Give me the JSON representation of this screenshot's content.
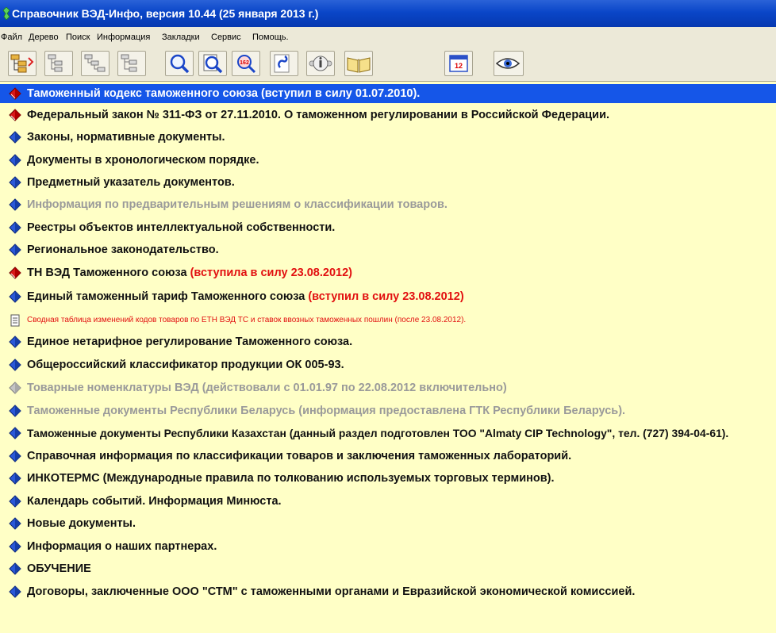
{
  "window": {
    "title": "Справочник ВЭД-Инфо, версия 10.44 (25 января 2013 г.)"
  },
  "menu": [
    {
      "label": "Файл"
    },
    {
      "label": "Дерево"
    },
    {
      "label": "Поиск"
    },
    {
      "label": "Информация"
    },
    {
      "label": "Закладки"
    },
    {
      "label": "Сервис"
    },
    {
      "label": "Помощь."
    }
  ],
  "toolbar": {
    "buttons": [
      {
        "icon": "tree-expand-icon"
      },
      {
        "icon": "tree-level-icon"
      },
      {
        "icon": "tree-level-icon"
      },
      {
        "icon": "tree-level-icon"
      },
      {
        "icon": "search-icon"
      },
      {
        "icon": "search-document-icon"
      },
      {
        "icon": "search-code-icon",
        "badge": "162"
      },
      {
        "icon": "bookmark-link-icon"
      },
      {
        "icon": "info-icon"
      },
      {
        "icon": "open-book-icon"
      },
      {
        "icon": "calendar-icon",
        "badge": "12"
      },
      {
        "icon": "eye-icon"
      }
    ]
  },
  "colors": {
    "selection": "#1556e8",
    "content_bg": "#ffffc6",
    "text": "#111111",
    "muted": "#9a9a9a",
    "accent_red": "#e21010",
    "bullet_blue": "#1b3fb8"
  },
  "tree": [
    {
      "text": "Таможенный кодекс таможенного союза (вступил в силу 01.07.2010).",
      "icon": "red-book-icon",
      "selected": true
    },
    {
      "text": "Федеральный закон № 311-ФЗ от 27.11.2010. О таможенном регулировании в Российской Федерации.",
      "icon": "red-book-icon"
    },
    {
      "text": "Законы, нормативные документы.",
      "icon": "blue-folder-icon"
    },
    {
      "text": "Документы в хронологическом порядке.",
      "icon": "blue-folder-icon"
    },
    {
      "text": "Предметный указатель документов.",
      "icon": "blue-folder-icon"
    },
    {
      "text": "Информация по предварительным решениям о классификации товаров.",
      "icon": "blue-folder-icon",
      "muted": true
    },
    {
      "text": "Реестры объектов интеллектуальной собственности.",
      "icon": "blue-folder-icon"
    },
    {
      "text": "Региональное законодательство.",
      "icon": "blue-folder-icon"
    },
    {
      "text": "ТН ВЭД Таможенного союза",
      "suffix": "(вступила в силу 23.08.2012)",
      "icon": "red-book-icon"
    },
    {
      "text": "Единый таможенный тариф Таможенного союза",
      "suffix": "(вступил в силу 23.08.2012)",
      "icon": "blue-folder-icon"
    },
    {
      "text": "Сводная таблица изменений кодов товаров по ЕТН ВЭД ТС и ставок ввозных таможенных пошлин (после 23.08.2012).",
      "icon": "document-icon",
      "small": true,
      "red": true
    },
    {
      "text": "Единое нетарифное регулирование Таможенного союза.",
      "icon": "blue-folder-icon"
    },
    {
      "text": "Общероссийский классификатор продукции ОК 005-93.",
      "icon": "blue-folder-icon"
    },
    {
      "text": "Товарные номенклатуры ВЭД (действовали с 01.01.97 по 22.08.2012 включительно)",
      "icon": "gray-folder-icon",
      "muted": true
    },
    {
      "text": "Таможенные документы Республики Беларусь (информация предоставлена ГТК Республики Беларусь).",
      "icon": "blue-folder-icon",
      "muted": true
    },
    {
      "text": "Таможенные документы Республики Казахстан (данный раздел подготовлен ТОО \"Almaty CIP Technology\", тел. (727) 394-04-61).",
      "icon": "blue-folder-icon"
    },
    {
      "text": "Справочная информация по классификации товаров и заключения таможенных лабораторий.",
      "icon": "blue-folder-icon"
    },
    {
      "text": "ИНКОТЕРМС (Международные правила по толкованию используемых торговых терминов).",
      "icon": "blue-folder-icon"
    },
    {
      "text": "Календарь событий. Информация Минюста.",
      "icon": "blue-folder-icon"
    },
    {
      "text": "Новые документы.",
      "icon": "blue-folder-icon"
    },
    {
      "text": "Информация о наших партнерах.",
      "icon": "blue-folder-icon"
    },
    {
      "text": "ОБУЧЕНИЕ",
      "icon": "blue-folder-icon"
    },
    {
      "text": "Договоры, заключенные ООО \"СТМ\" с таможенными органами и Евразийской экономической комиссией.",
      "icon": "blue-folder-icon"
    }
  ]
}
